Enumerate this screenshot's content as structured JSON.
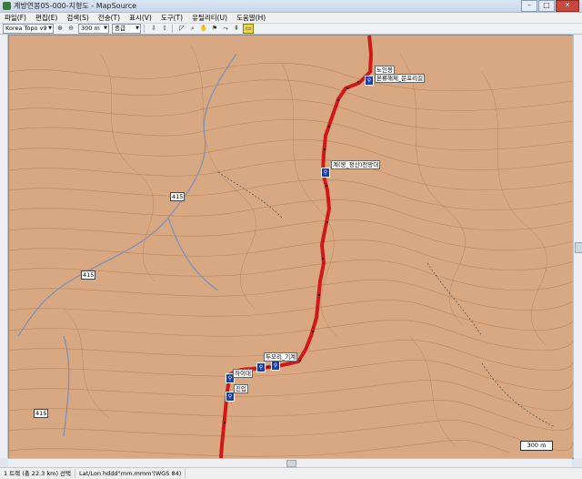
{
  "window": {
    "title": "계방연봉05-000-지형도 - MapSource",
    "buttons": {
      "minimize": "–",
      "maximize": "□",
      "close": "✕"
    }
  },
  "menu": [
    "파일(F)",
    "편집(E)",
    "검색(S)",
    "전송(T)",
    "표시(V)",
    "도구(T)",
    "유틸리티(U)",
    "도움말(H)"
  ],
  "toolbar": {
    "map_product": "Korea Topo v9",
    "zoom_level": "300 m",
    "detail": "중급",
    "icons": [
      "zoom-in-icon",
      "zoom-out-icon",
      "device-receive-icon",
      "device-send-icon",
      "select-icon",
      "zoom-tool-icon",
      "hand-icon",
      "waypoint-icon",
      "route-icon",
      "track-icon",
      "measure-icon"
    ]
  },
  "map": {
    "waypoints": [
      {
        "name": "노인봉",
        "sub": "본류해제_문포리길"
      },
      {
        "name": "계(봉_정산)전망대"
      },
      {
        "name": "두모리_기계"
      },
      {
        "name": "하이대"
      },
      {
        "name": "진입"
      }
    ],
    "route_numbers": [
      "415",
      "415",
      "415"
    ],
    "scale_label": "300 m",
    "colors": {
      "terrain": "#d8a882",
      "track": "#d01818",
      "contour": "#b07850",
      "road": "#7c8fb8"
    }
  },
  "status": {
    "track_info": "1 트랙 (총 22.3 km) 선택",
    "position_format": "Lat/Lon hddd°mm.mmm'(WGS 84)"
  }
}
